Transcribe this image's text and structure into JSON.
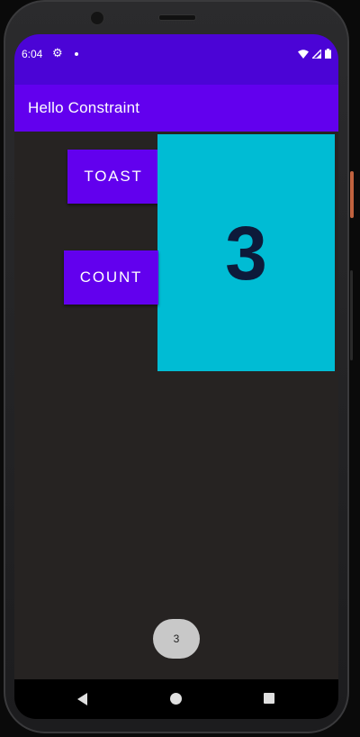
{
  "status_bar": {
    "time": "6:04",
    "settings_icon": "gear-icon",
    "notification_icon": "dot-icon",
    "icons": [
      "wifi-icon",
      "signal-icon",
      "battery-icon"
    ],
    "background": "#4b04d6"
  },
  "app_bar": {
    "title": "Hello Constraint",
    "background": "#6200ee"
  },
  "main": {
    "toast_button_label": "TOAST",
    "count_button_label": "COUNT",
    "count_value": "3",
    "count_background": "#00bcd4",
    "button_color": "#6200ee"
  },
  "toast": {
    "message": "3"
  },
  "nav_bar": {
    "icons": [
      "back-icon",
      "home-icon",
      "recents-icon"
    ]
  }
}
